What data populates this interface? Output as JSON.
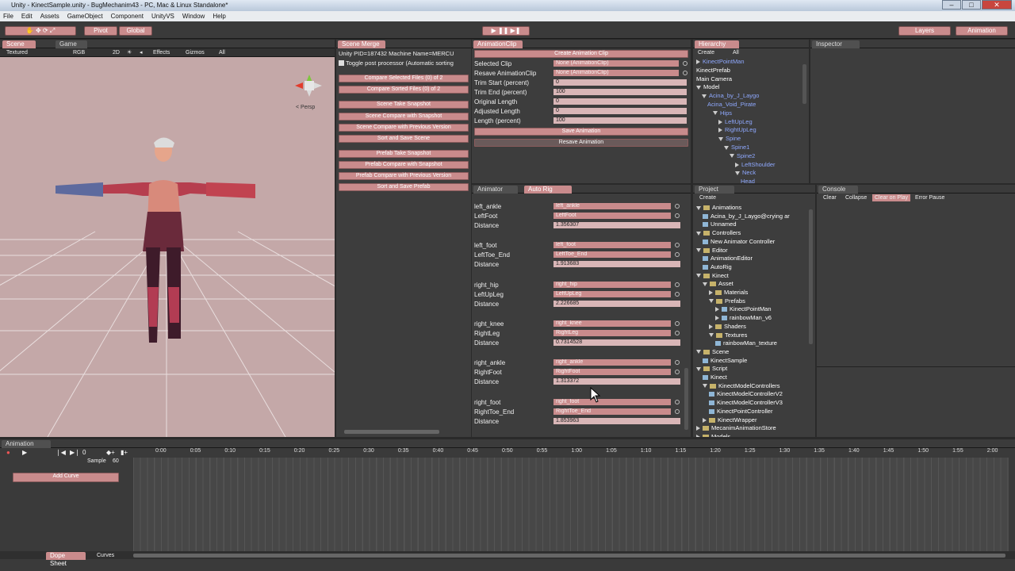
{
  "window": {
    "title": "Unity - KinectSample.unity - BugMechanim43 - PC, Mac & Linux Standalone*"
  },
  "menu": [
    "File",
    "Edit",
    "Assets",
    "GameObject",
    "Component",
    "UnityVS",
    "Window",
    "Help"
  ],
  "toolbar": {
    "pivot": "Pivot",
    "global": "Global",
    "layers": "Layers",
    "layout": "Animation"
  },
  "scene": {
    "tabs": [
      "Scene",
      "Game"
    ],
    "shading": "Textured",
    "channel": "RGB",
    "mode_2d": "2D",
    "effects": "Effects",
    "gizmos": "Gizmos",
    "search": "All",
    "persp": "< Persp"
  },
  "scene_merge": {
    "tab": "Scene Merge",
    "pid_text": "Unity PID=187432 Machine Name=MERCU",
    "toggle_text": "Toggle post processor (Automatic sorting",
    "buttons": [
      "Compare Selected Files (0) of 2",
      "Compare Sorted Files (0) of 2",
      "Scene Take Snapshot",
      "Scene Compare with Snapshot",
      "Scene Compare with Previous Version",
      "Sort and Save Scene",
      "Prefab Take Snapshot",
      "Prefab Compare with Snapshot",
      "Prefab Compare with Previous Version",
      "Sort and Save Prefab"
    ]
  },
  "animclip": {
    "tab": "AnimationClip",
    "create_btn": "Create Animation Clip",
    "rows": [
      {
        "label": "Selected Clip",
        "value": "None (AnimationClip)"
      },
      {
        "label": "Resave AnimationClip",
        "value": "None (AnimationClip)"
      },
      {
        "label": "Trim Start (percent)",
        "value": "0"
      },
      {
        "label": "Trim End (percent)",
        "value": "100"
      },
      {
        "label": "Original Length",
        "value": "0"
      },
      {
        "label": "Adjusted Length",
        "value": "0"
      },
      {
        "label": "Length (percent)",
        "value": "100"
      }
    ],
    "save_btn": "Save Animation",
    "resave_btn": "Resave Animation"
  },
  "animator": {
    "tabs": [
      "Animator",
      "Auto Rig"
    ],
    "rows": [
      {
        "a": "left_ankle",
        "av": "left_ankle",
        "b": "LeftFoot",
        "bv": "LeftFoot",
        "dist": "1.356307"
      },
      {
        "a": "left_foot",
        "av": "left_foot",
        "b": "LeftToe_End",
        "bv": "LeftToe_End",
        "dist": "1.913683"
      },
      {
        "a": "right_hip",
        "av": "right_hip",
        "b": "LeftUpLeg",
        "bv": "LeftUpLeg",
        "dist": "2.226685"
      },
      {
        "a": "right_knee",
        "av": "right_knee",
        "b": "RightLeg",
        "bv": "RightLeg",
        "dist": "0.7314528"
      },
      {
        "a": "right_ankle",
        "av": "right_ankle",
        "b": "RightFoot",
        "bv": "RightFoot",
        "dist": "1.313372"
      },
      {
        "a": "right_foot",
        "av": "right_foot",
        "b": "RightToe_End",
        "bv": "RightToe_End",
        "dist": "1.853963"
      }
    ],
    "distance_label": "Distance"
  },
  "hierarchy": {
    "tab": "Hierarchy",
    "create": "Create",
    "search": "All",
    "items": [
      "KinectPointMan",
      "KinectPrefab",
      "Main Camera",
      "Model",
      "Acina_by_J_Laygo",
      "Acina_Void_Pirate",
      "Hips",
      "LeftUpLeg",
      "RightUpLeg",
      "Spine",
      "Spine1",
      "Spine2",
      "LeftShoulder",
      "Neck",
      "Head"
    ]
  },
  "inspector": {
    "tab": "Inspector"
  },
  "project": {
    "tab": "Project",
    "create": "Create",
    "items": [
      "Animations",
      "Acina_by_J_Laygo@crying ar",
      "Unnamed",
      "Controllers",
      "New Animator Controller",
      "Editor",
      "AnimationEditor",
      "AutoRig",
      "Kinect",
      "Asset",
      "Materials",
      "Prefabs",
      "KinectPointMan",
      "rainbowMan_v6",
      "Shaders",
      "Textures",
      "rainbowMan_texture",
      "Scene",
      "KinectSample",
      "Script",
      "Kinect",
      "KinectModelControllers",
      "KinectModelControllerV2",
      "KinectModelControllerV3",
      "KinectPointController",
      "KinectWrapper",
      "MecanimAnimationStore",
      "Models"
    ]
  },
  "console": {
    "tab": "Console",
    "clear": "Clear",
    "collapse": "Collapse",
    "clear_on_play": "Clear on Play",
    "error_pause": "Error Pause"
  },
  "animation": {
    "tab": "Animation",
    "frame": "0",
    "sample_label": "Sample",
    "sample_value": "60",
    "add_curve": "Add Curve",
    "dope": "Dope Sheet",
    "curves": "Curves",
    "ticks": [
      "0:00",
      "0:05",
      "0:10",
      "0:15",
      "0:20",
      "0:25",
      "0:30",
      "0:35",
      "0:40",
      "0:45",
      "0:50",
      "0:55",
      "1:00",
      "1:05",
      "1:10",
      "1:15",
      "1:20",
      "1:25",
      "1:30",
      "1:35",
      "1:40",
      "1:45",
      "1:50",
      "1:55",
      "2:00"
    ]
  }
}
